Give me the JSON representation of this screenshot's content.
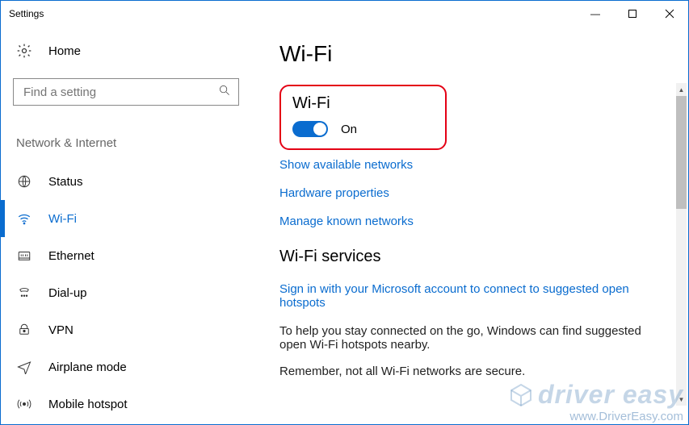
{
  "window": {
    "title": "Settings"
  },
  "sidebar": {
    "home_label": "Home",
    "search_placeholder": "Find a setting",
    "category": "Network & Internet",
    "items": [
      {
        "id": "status",
        "label": "Status",
        "active": false
      },
      {
        "id": "wifi",
        "label": "Wi-Fi",
        "active": true
      },
      {
        "id": "ethernet",
        "label": "Ethernet",
        "active": false
      },
      {
        "id": "dialup",
        "label": "Dial-up",
        "active": false
      },
      {
        "id": "vpn",
        "label": "VPN",
        "active": false
      },
      {
        "id": "airplane",
        "label": "Airplane mode",
        "active": false
      },
      {
        "id": "hotspot",
        "label": "Mobile hotspot",
        "active": false
      }
    ]
  },
  "main": {
    "title": "Wi-Fi",
    "wifi_section_label": "Wi-Fi",
    "toggle": {
      "on": true,
      "state_label": "On"
    },
    "links": {
      "show_networks": "Show available networks",
      "hardware": "Hardware properties",
      "manage_known": "Manage known networks",
      "signin": "Sign in with your Microsoft account to connect to suggested open hotspots"
    },
    "services_header": "Wi-Fi services",
    "desc1": "To help you stay connected on the go, Windows can find suggested open Wi-Fi hotspots nearby.",
    "desc2": "Remember, not all Wi-Fi networks are secure."
  },
  "watermark": {
    "brand": "driver easy",
    "url": "www.DriverEasy.com"
  },
  "colors": {
    "accent": "#0a6ccf",
    "highlight": "#e40015"
  }
}
